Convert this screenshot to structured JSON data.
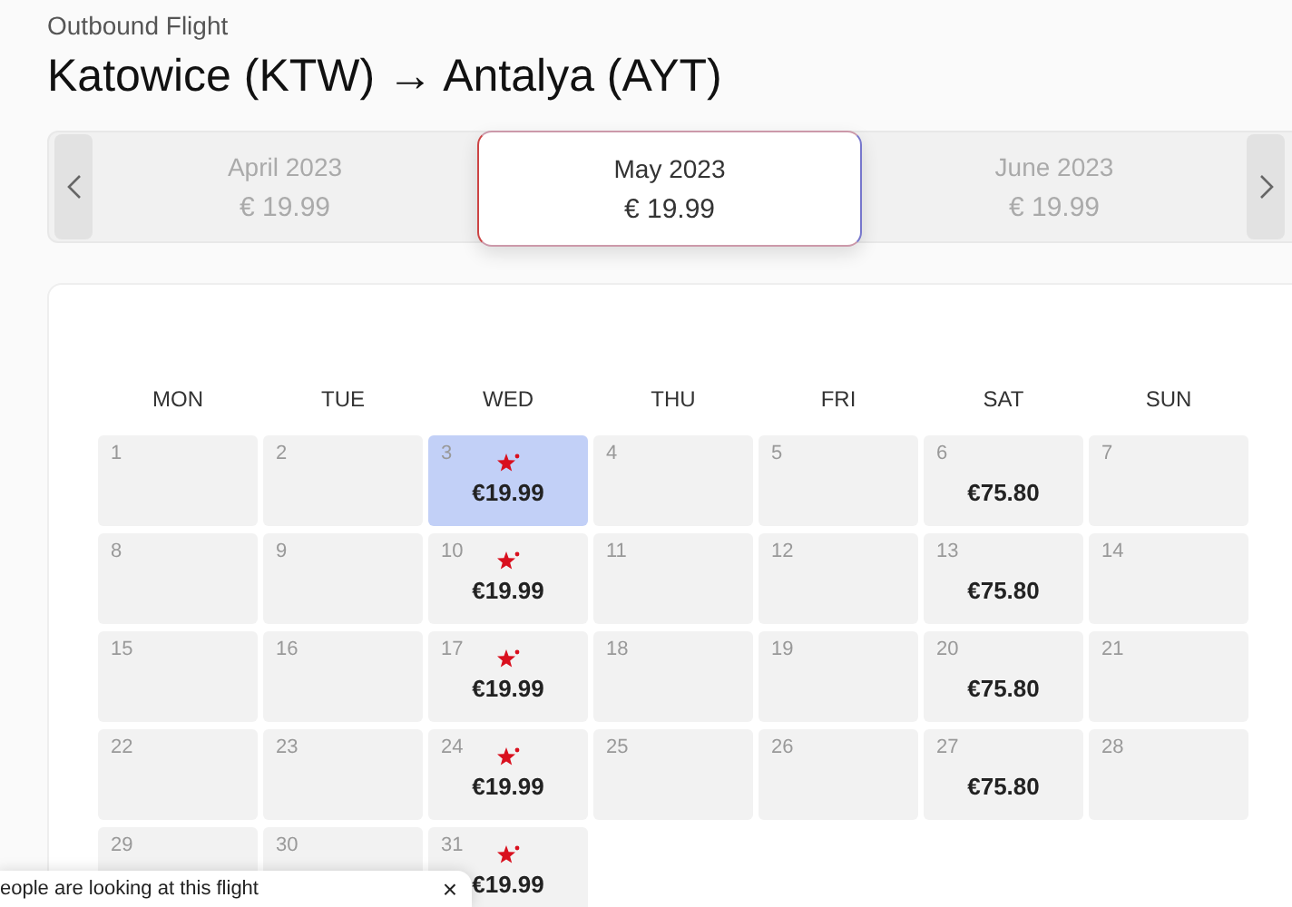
{
  "subtitle": "Outbound Flight",
  "title": "Katowice (KTW) → Antalya (AYT)",
  "months": [
    {
      "name": "April 2023",
      "price": "€ 19.99",
      "selected": false
    },
    {
      "name": "May 2023",
      "price": "€ 19.99",
      "selected": true
    },
    {
      "name": "June 2023",
      "price": "€ 19.99",
      "selected": false
    }
  ],
  "weekdays": [
    "MON",
    "TUE",
    "WED",
    "THU",
    "FRI",
    "SAT",
    "SUN"
  ],
  "weeks": [
    [
      {
        "day": "1",
        "selected": false
      },
      {
        "day": "2",
        "selected": false
      },
      {
        "day": "3",
        "price": "€19.99",
        "promo": true,
        "selected": true
      },
      {
        "day": "4",
        "selected": false
      },
      {
        "day": "5",
        "selected": false
      },
      {
        "day": "6",
        "price": "€75.80",
        "selected": false
      },
      {
        "day": "7",
        "selected": false
      }
    ],
    [
      {
        "day": "8",
        "selected": false
      },
      {
        "day": "9",
        "selected": false
      },
      {
        "day": "10",
        "price": "€19.99",
        "promo": true,
        "selected": false
      },
      {
        "day": "11",
        "selected": false
      },
      {
        "day": "12",
        "selected": false
      },
      {
        "day": "13",
        "price": "€75.80",
        "selected": false
      },
      {
        "day": "14",
        "selected": false
      }
    ],
    [
      {
        "day": "15",
        "selected": false
      },
      {
        "day": "16",
        "selected": false
      },
      {
        "day": "17",
        "price": "€19.99",
        "promo": true,
        "selected": false
      },
      {
        "day": "18",
        "selected": false
      },
      {
        "day": "19",
        "selected": false
      },
      {
        "day": "20",
        "price": "€75.80",
        "selected": false
      },
      {
        "day": "21",
        "selected": false
      }
    ],
    [
      {
        "day": "22",
        "selected": false
      },
      {
        "day": "23",
        "selected": false
      },
      {
        "day": "24",
        "price": "€19.99",
        "promo": true,
        "selected": false
      },
      {
        "day": "25",
        "selected": false
      },
      {
        "day": "26",
        "selected": false
      },
      {
        "day": "27",
        "price": "€75.80",
        "selected": false
      },
      {
        "day": "28",
        "selected": false
      }
    ],
    [
      {
        "day": "29",
        "selected": false
      },
      {
        "day": "30",
        "selected": false
      },
      {
        "day": "31",
        "price": "€19.99",
        "promo": true,
        "selected": false
      }
    ]
  ],
  "toast": {
    "text": "eople are looking at this flight",
    "close": "×"
  }
}
